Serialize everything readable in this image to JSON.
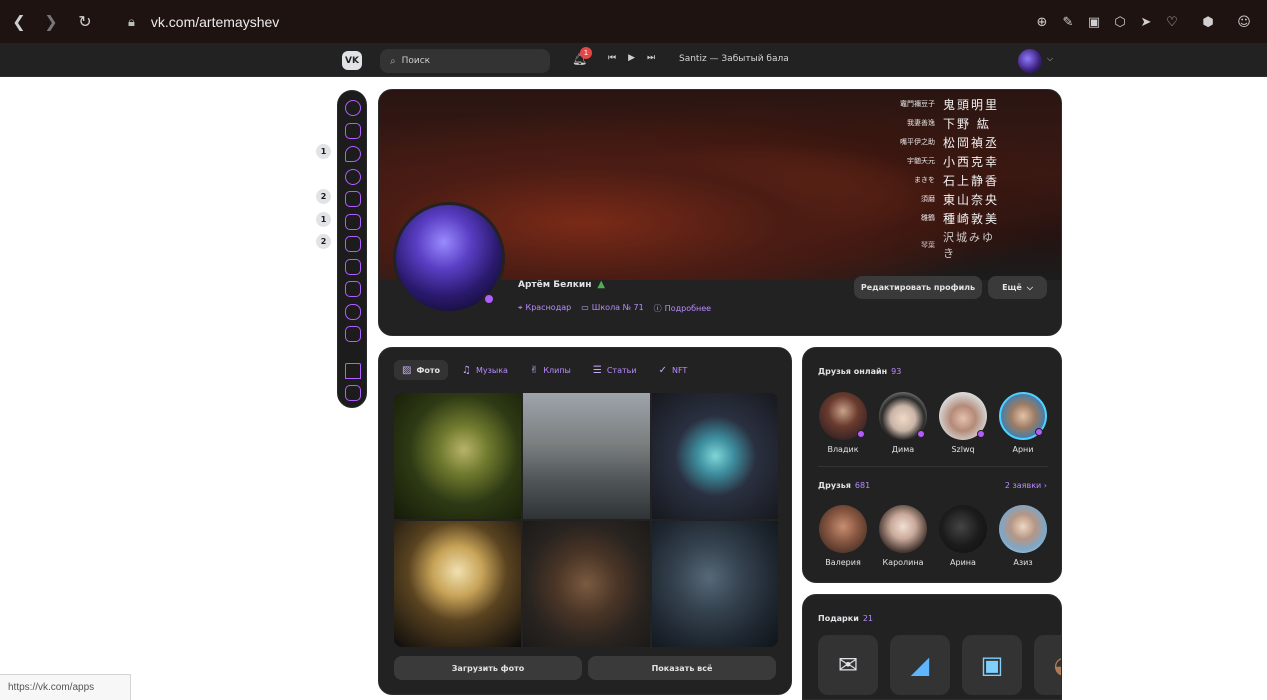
{
  "browser": {
    "url": "vk.com/artemayshev",
    "status_url": "https://vk.com/apps"
  },
  "header": {
    "logo": "VK",
    "search_placeholder": "Поиск",
    "notifications_count": "1",
    "track": "Santiz — Забытый бала"
  },
  "rail": {
    "badges": [
      "1",
      "2",
      "1",
      "2"
    ]
  },
  "cover": {
    "credits": [
      {
        "role": "竈門禰豆子",
        "name": "鬼頭明里"
      },
      {
        "role": "我妻善逸",
        "name": "下野 紘"
      },
      {
        "role": "嘴平伊之助",
        "name": "松岡禎丞"
      },
      {
        "role": "宇髄天元",
        "name": "小西克幸"
      },
      {
        "role": "まきを",
        "name": "石上静香"
      },
      {
        "role": "須磨",
        "name": "東山奈央"
      },
      {
        "role": "雛鶴",
        "name": "種崎敦美"
      },
      {
        "role": "琴葉",
        "name": "沢城みゆき"
      }
    ]
  },
  "profile": {
    "name": "Артём Белкин",
    "city": "Краснодар",
    "school": "Школа № 71",
    "more_info": "Подробнее",
    "edit_button": "Редактировать профиль",
    "more_button": "Ещё"
  },
  "photos": {
    "tabs": [
      {
        "label": "Фото",
        "icon": "image-icon"
      },
      {
        "label": "Музыка",
        "icon": "music-icon"
      },
      {
        "label": "Клипы",
        "icon": "clips-icon"
      },
      {
        "label": "Статьи",
        "icon": "article-icon"
      },
      {
        "label": "NFT",
        "icon": "nft-icon"
      }
    ],
    "upload_button": "Загрузить фото",
    "show_all_button": "Показать всё"
  },
  "friends": {
    "online_title": "Друзья онлайн",
    "online_count": "93",
    "online": [
      "Владик",
      "Дима",
      "Szlwq",
      "Арни"
    ],
    "all_title": "Друзья",
    "all_count": "681",
    "requests": "2 заявки",
    "list": [
      "Валерия",
      "Каролина",
      "Арина",
      "Азиз"
    ]
  },
  "gifts": {
    "title": "Подарки",
    "count": "21"
  }
}
